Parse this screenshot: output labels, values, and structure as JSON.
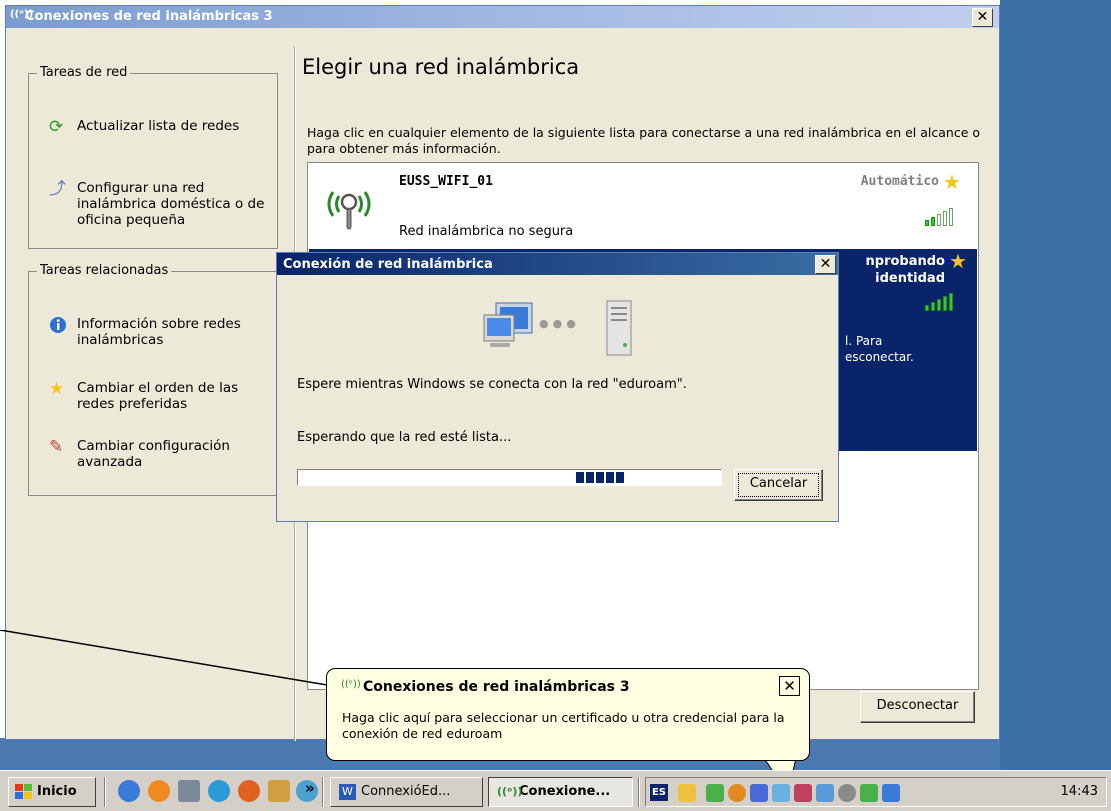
{
  "window": {
    "title": "Conexiones de red inalámbricas 3",
    "close_glyph": "✕"
  },
  "left_panel": {
    "network_tasks": {
      "legend": "Tareas de red",
      "items": [
        {
          "label": "Actualizar lista de redes",
          "icon": "refresh-icon"
        },
        {
          "label": "Configurar una red inalámbrica doméstica o de oficina pequeña",
          "icon": "setup-wizard-icon"
        }
      ]
    },
    "related_tasks": {
      "legend": "Tareas relacionadas",
      "items": [
        {
          "label": "Información sobre redes inalámbricas",
          "icon": "info-icon"
        },
        {
          "label": "Cambiar el orden de las redes preferidas",
          "icon": "star-icon"
        },
        {
          "label": "Cambiar configuración avanzada",
          "icon": "wrench-icon"
        }
      ]
    }
  },
  "main": {
    "title": "Elegir una red inalámbrica",
    "description": "Haga clic en cualquier elemento de la siguiente lista para conectarse a una red inalámbrica en el alcance o para obtener más información.",
    "networks": [
      {
        "name": "EUSS_WIFI_01",
        "status": "Red inalámbrica no segura",
        "mode": "Automático",
        "signal_bars": 2,
        "selected": false
      },
      {
        "status_line1": "nprobando",
        "status_line2": "identidad",
        "message_line1": "l. Para",
        "message_line2": "esconectar.",
        "signal_bars": 5,
        "selected": true
      }
    ],
    "disconnect_button": "Desconectar"
  },
  "dialog": {
    "title": "Conexión de red inalámbrica",
    "message": "Espere mientras Windows se conecta con la red \"eduroam\".",
    "status": "Esperando que la red esté lista...",
    "cancel_button": "Cancelar",
    "progress_blocks": 5
  },
  "balloon": {
    "title": "Conexiones de red inalámbricas 3",
    "text": "Haga clic aquí para seleccionar un certificado u otra credencial para la conexión de red eduroam",
    "close_glyph": "✕"
  },
  "taskbar": {
    "start_label": "Inicio",
    "quick_launch_chevron": "»",
    "buttons": [
      {
        "label": "ConnexióEd...",
        "active": false
      },
      {
        "label": "Conexione...",
        "active": true
      }
    ],
    "language": "ES",
    "clock": "14:43"
  },
  "colors": {
    "selection": "#0a246a",
    "window_face": "#ece9d8",
    "balloon": "#ffffe1",
    "desktop": "#3a6ea5"
  }
}
